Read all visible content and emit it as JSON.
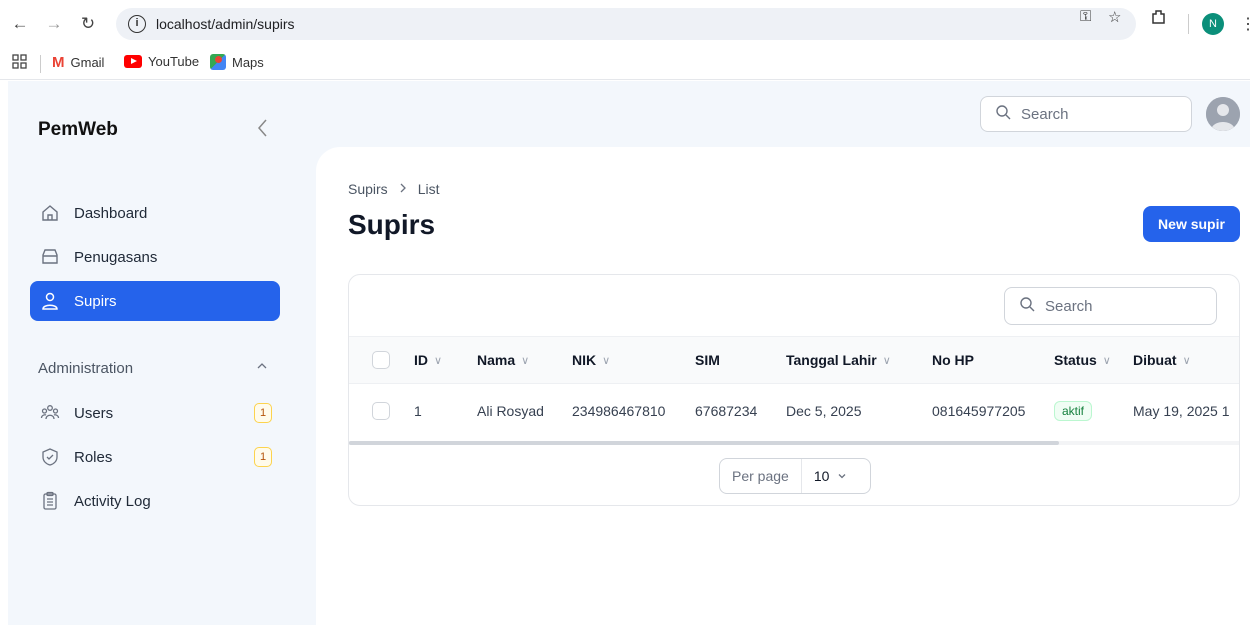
{
  "browser": {
    "url": "localhost/admin/supirs",
    "profile_initial": "N",
    "bookmarks": [
      {
        "label": "Gmail"
      },
      {
        "label": "YouTube"
      },
      {
        "label": "Maps"
      }
    ]
  },
  "sidebar": {
    "brand": "PemWeb",
    "items": [
      {
        "label": "Dashboard",
        "icon": "home-icon",
        "active": false
      },
      {
        "label": "Penugasans",
        "icon": "inbox-icon",
        "active": false
      },
      {
        "label": "Supirs",
        "icon": "user-icon",
        "active": true
      }
    ],
    "group": {
      "label": "Administration",
      "items": [
        {
          "label": "Users",
          "icon": "users-icon",
          "badge": "1"
        },
        {
          "label": "Roles",
          "icon": "shield-check-icon",
          "badge": "1"
        },
        {
          "label": "Activity Log",
          "icon": "clipboard-icon",
          "badge": ""
        }
      ]
    }
  },
  "topbar": {
    "search_placeholder": "Search"
  },
  "page": {
    "breadcrumb": [
      "Supirs",
      "List"
    ],
    "title": "Supirs",
    "new_button": "New supir"
  },
  "table": {
    "search_placeholder": "Search",
    "columns": [
      "ID",
      "Nama",
      "NIK",
      "SIM",
      "Tanggal Lahir",
      "No HP",
      "Status",
      "Dibuat"
    ],
    "rows": [
      {
        "id": "1",
        "nama": "Ali Rosyad",
        "nik": "234986467810",
        "sim": "67687234",
        "tanggal_lahir": "Dec 5, 2025",
        "no_hp": "081645977205",
        "status": "aktif",
        "dibuat": "May 19, 2025 1"
      }
    ],
    "per_page_label": "Per page",
    "per_page_value": "10"
  },
  "colors": {
    "accent": "#2563eb",
    "status_active": "#15803d"
  }
}
